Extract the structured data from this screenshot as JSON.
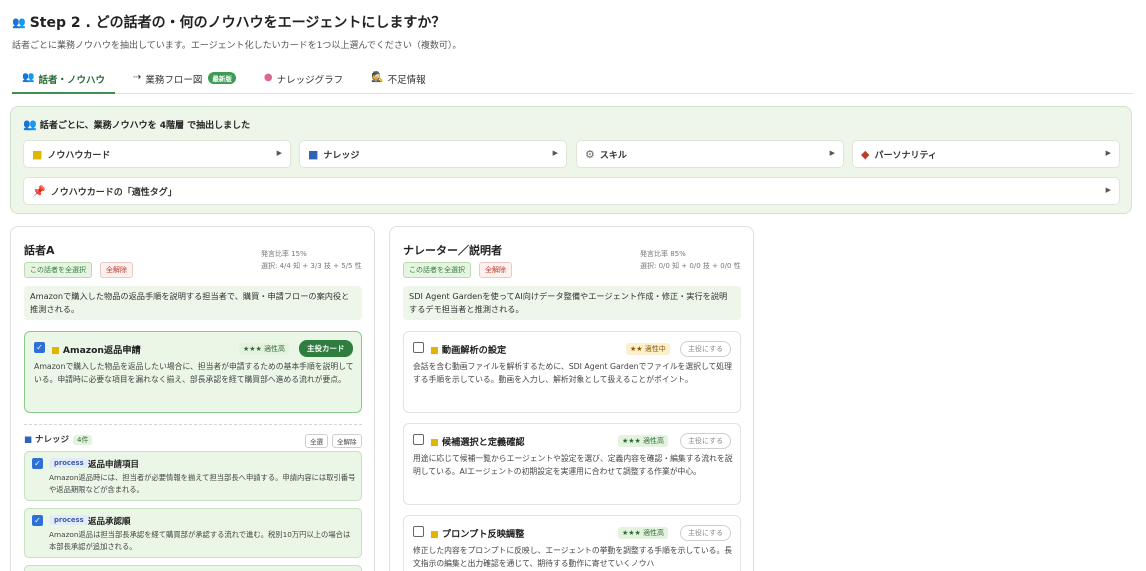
{
  "header": {
    "title": "Step 2 . どの話者の・何のノウハウをエージェントにしますか？",
    "subtitle": "話者ごとに業務ノウハウを抽出しています。エージェント化したいカードを1つ以上選んでください（複数可）。"
  },
  "tabs": [
    {
      "label": "話者・ノウハウ",
      "icon": "people-icon",
      "active": true
    },
    {
      "label": "業務フロー図",
      "icon": "flow-icon",
      "badge": "最新版"
    },
    {
      "label": "ナレッジグラフ",
      "icon": "brain-icon"
    },
    {
      "label": "不足情報",
      "icon": "detective-icon"
    }
  ],
  "overview": {
    "heading_pre": "話者ごとに、業務ノウハウを ",
    "heading_bold": "4階層",
    "heading_post": " で抽出しました",
    "tiles": [
      {
        "label": "ノウハウカード",
        "icon": "notebook-icon"
      },
      {
        "label": "ナレッジ",
        "icon": "book-icon"
      },
      {
        "label": "スキル",
        "icon": "gear-icon"
      },
      {
        "label": "パーソナリティ",
        "icon": "mask-icon"
      }
    ],
    "tag_tile": {
      "label": "ノウハウカードの「適性タグ」",
      "icon": "pin-icon"
    }
  },
  "speakers": [
    {
      "name": "話者A",
      "ratio": "発言比率 15%",
      "selection": "選択: 4/4 知 + 3/3 技 + 5/5 性",
      "select_all": "この話者を全選択",
      "clear": "全解除",
      "description": "Amazonで購入した物品の返品手順を説明する担当者で、購買・申請フローの案内役と推測される。",
      "card": {
        "checked": true,
        "icon": "notebook-icon",
        "title": "Amazon返品申請",
        "stars": "★★★ 適性高",
        "role": "主役カード",
        "body": "Amazonで購入した物品を返品したい場合に、担当者が申請するための基本手順を説明している。申請時に必要な項目を漏れなく揃え、部長承認を経て購買部へ進める流れが要点。"
      },
      "knowledge": {
        "label": "ナレッジ",
        "icon": "book-icon",
        "count": "4件",
        "select_all": "全選",
        "clear": "全解除",
        "items": [
          {
            "checked": true,
            "tag": "process",
            "title": "返品申請項目",
            "body": "Amazon返品時には、担当者が必要情報を揃えて担当部長へ申請する。申請内容には取引番号や返品期限などが含まれる。"
          },
          {
            "checked": true,
            "tag": "process",
            "title": "返品承認順",
            "body": "Amazon返品は担当部長承認を経て購買部が承認する流れで進む。税別10万円以上の場合は本部長承認が追加される。"
          }
        ]
      }
    },
    {
      "name": "ナレーター／説明者",
      "ratio": "発言比率 85%",
      "selection": "選択: 0/0 知 + 0/0 技 + 0/0 性",
      "select_all": "この話者を全選択",
      "clear": "全解除",
      "description": "SDI Agent Gardenを使ってAI向けデータ整備やエージェント作成・修正・実行を説明するデモ担当者と推測される。",
      "cards": [
        {
          "checked": false,
          "icon": "notebook-icon",
          "title": "動画解析の設定",
          "stars": "★★ 適性中",
          "role": "主役にする",
          "body": "会話を含む動画ファイルを解析するために、SDI Agent Gardenでファイルを選択して処理する手順を示している。動画を入力し、解析対象として扱えることがポイント。"
        },
        {
          "checked": false,
          "icon": "notebook-icon",
          "title": "候補選択と定義確認",
          "stars": "★★★ 適性高",
          "role": "主役にする",
          "body": "用途に応じて候補一覧からエージェントや設定を選び、定義内容を確認・編集する流れを説明している。AIエージェントの初期設定を実運用に合わせて調整する作業が中心。"
        },
        {
          "checked": false,
          "icon": "notebook-icon",
          "title": "プロンプト反映調整",
          "stars": "★★★ 適性高",
          "role": "主役にする",
          "body": "修正した内容をプロンプトに反映し、エージェントの挙動を調整する手順を示している。長文指示の編集と出力確認を通じて、期待する動作に寄せていくノウハ"
        }
      ]
    }
  ]
}
